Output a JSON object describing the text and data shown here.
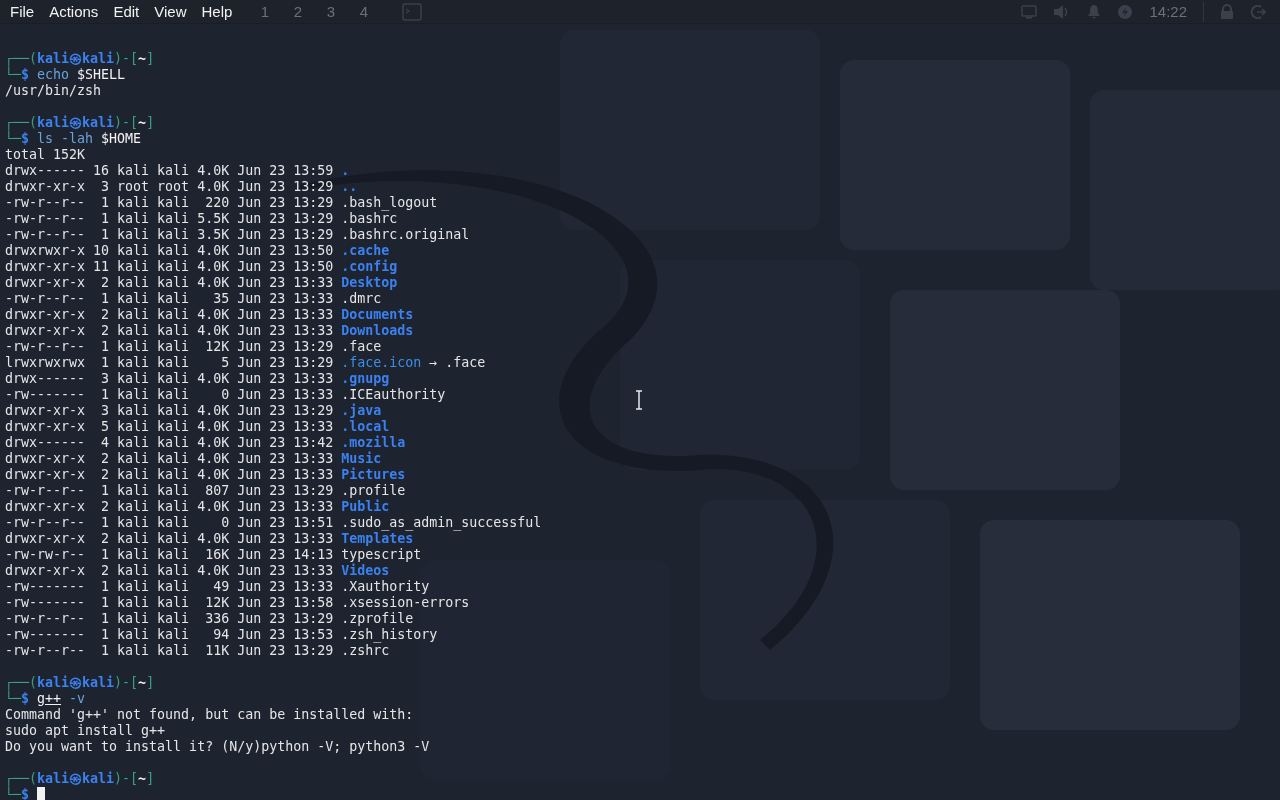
{
  "menu": [
    {
      "label": "File"
    },
    {
      "label": "Actions"
    },
    {
      "label": "Edit"
    },
    {
      "label": "View"
    },
    {
      "label": "Help"
    }
  ],
  "panel": {
    "workspaces": [
      "1",
      "2",
      "3",
      "4"
    ],
    "clock": "14:22"
  },
  "terminal": [
    {
      "kind": "prompt",
      "open": "┌──(",
      "user": "kali㉿kali",
      "mid": ")-[",
      "dir": "~",
      "close": "]",
      "corner": "└─",
      "sign": "$",
      "command": {
        "program": "echo",
        "args": "$SHELL",
        "found": true
      }
    },
    {
      "kind": "output",
      "lines": [
        "/usr/bin/zsh"
      ]
    },
    {
      "kind": "prompt",
      "open": "┌──(",
      "user": "kali㉿kali",
      "mid": ")-[",
      "dir": "~",
      "close": "]",
      "corner": "└─",
      "sign": "$",
      "command": {
        "program": "ls",
        "options": "-lah",
        "args": "$HOME",
        "found": true
      }
    },
    {
      "kind": "output",
      "lines": [
        "total 152K"
      ]
    },
    {
      "kind": "listing",
      "rows": [
        {
          "meta": "drwx------ 16 kali kali 4.0K Jun 23 13:59",
          "name": ".",
          "kind": "dir"
        },
        {
          "meta": "drwxr-xr-x  3 root root 4.0K Jun 23 13:29",
          "name": "..",
          "kind": "dir"
        },
        {
          "meta": "-rw-r--r--  1 kali kali  220 Jun 23 13:29",
          "name": ".bash_logout",
          "kind": "file"
        },
        {
          "meta": "-rw-r--r--  1 kali kali 5.5K Jun 23 13:29",
          "name": ".bashrc",
          "kind": "file"
        },
        {
          "meta": "-rw-r--r--  1 kali kali 3.5K Jun 23 13:29",
          "name": ".bashrc.original",
          "kind": "file"
        },
        {
          "meta": "drwxrwxr-x 10 kali kali 4.0K Jun 23 13:50",
          "name": ".cache",
          "kind": "dir"
        },
        {
          "meta": "drwxr-xr-x 11 kali kali 4.0K Jun 23 13:50",
          "name": ".config",
          "kind": "dir"
        },
        {
          "meta": "drwxr-xr-x  2 kali kali 4.0K Jun 23 13:33",
          "name": "Desktop",
          "kind": "dir"
        },
        {
          "meta": "-rw-r--r--  1 kali kali   35 Jun 23 13:33",
          "name": ".dmrc",
          "kind": "file"
        },
        {
          "meta": "drwxr-xr-x  2 kali kali 4.0K Jun 23 13:33",
          "name": "Documents",
          "kind": "dir"
        },
        {
          "meta": "drwxr-xr-x  2 kali kali 4.0K Jun 23 13:33",
          "name": "Downloads",
          "kind": "dir"
        },
        {
          "meta": "-rw-r--r--  1 kali kali  12K Jun 23 13:29",
          "name": ".face",
          "kind": "file"
        },
        {
          "meta": "lrwxrwxrwx  1 kali kali    5 Jun 23 13:29",
          "name": ".face.icon",
          "kind": "link",
          "arrow": "→",
          "target": ".face"
        },
        {
          "meta": "drwx------  3 kali kali 4.0K Jun 23 13:33",
          "name": ".gnupg",
          "kind": "dir"
        },
        {
          "meta": "-rw-------  1 kali kali    0 Jun 23 13:33",
          "name": ".ICEauthority",
          "kind": "file"
        },
        {
          "meta": "drwxr-xr-x  3 kali kali 4.0K Jun 23 13:29",
          "name": ".java",
          "kind": "dir"
        },
        {
          "meta": "drwxr-xr-x  5 kali kali 4.0K Jun 23 13:33",
          "name": ".local",
          "kind": "dir"
        },
        {
          "meta": "drwx------  4 kali kali 4.0K Jun 23 13:42",
          "name": ".mozilla",
          "kind": "dir"
        },
        {
          "meta": "drwxr-xr-x  2 kali kali 4.0K Jun 23 13:33",
          "name": "Music",
          "kind": "dir"
        },
        {
          "meta": "drwxr-xr-x  2 kali kali 4.0K Jun 23 13:33",
          "name": "Pictures",
          "kind": "dir"
        },
        {
          "meta": "-rw-r--r--  1 kali kali  807 Jun 23 13:29",
          "name": ".profile",
          "kind": "file"
        },
        {
          "meta": "drwxr-xr-x  2 kali kali 4.0K Jun 23 13:33",
          "name": "Public",
          "kind": "dir"
        },
        {
          "meta": "-rw-r--r--  1 kali kali    0 Jun 23 13:51",
          "name": ".sudo_as_admin_successful",
          "kind": "file"
        },
        {
          "meta": "drwxr-xr-x  2 kali kali 4.0K Jun 23 13:33",
          "name": "Templates",
          "kind": "dir"
        },
        {
          "meta": "-rw-rw-r--  1 kali kali  16K Jun 23 14:13",
          "name": "typescript",
          "kind": "file"
        },
        {
          "meta": "drwxr-xr-x  2 kali kali 4.0K Jun 23 13:33",
          "name": "Videos",
          "kind": "dir"
        },
        {
          "meta": "-rw-------  1 kali kali   49 Jun 23 13:33",
          "name": ".Xauthority",
          "kind": "file"
        },
        {
          "meta": "-rw-------  1 kali kali  12K Jun 23 13:58",
          "name": ".xsession-errors",
          "kind": "file"
        },
        {
          "meta": "-rw-r--r--  1 kali kali  336 Jun 23 13:29",
          "name": ".zprofile",
          "kind": "file"
        },
        {
          "meta": "-rw-------  1 kali kali   94 Jun 23 13:53",
          "name": ".zsh_history",
          "kind": "file"
        },
        {
          "meta": "-rw-r--r--  1 kali kali  11K Jun 23 13:29",
          "name": ".zshrc",
          "kind": "file"
        }
      ]
    },
    {
      "kind": "prompt",
      "open": "┌──(",
      "user": "kali㉿kali",
      "mid": ")-[",
      "dir": "~",
      "close": "]",
      "corner": "└─",
      "sign": "$",
      "command": {
        "program": "g++",
        "options": "-v",
        "found": false
      }
    },
    {
      "kind": "output",
      "lines": [
        "Command 'g++' not found, but can be installed with:",
        "sudo apt install g++",
        "Do you want to install it? (N/y)python -V; python3 -V"
      ]
    },
    {
      "kind": "prompt",
      "open": "┌──(",
      "user": "kali㉿kali",
      "mid": ")-[",
      "dir": "~",
      "close": "]",
      "corner": "└─",
      "sign": "$",
      "cursor": true
    }
  ]
}
